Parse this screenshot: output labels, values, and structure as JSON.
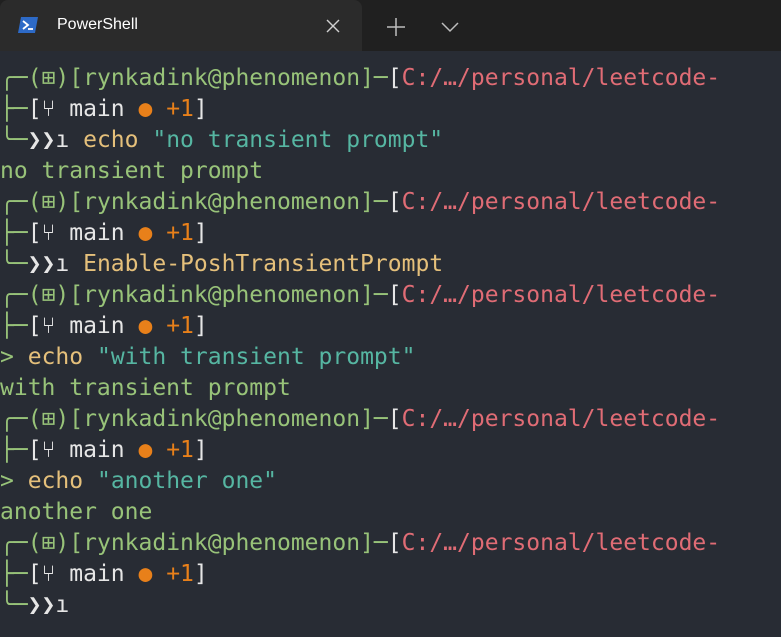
{
  "tab": {
    "title": "PowerShell"
  },
  "prompt": {
    "box_tl": "╭─",
    "box_ml": "├─",
    "box_bl": "╰─",
    "open_paren": "(",
    "close_paren": ")",
    "user_host": "[rynkadink@phenomenon]",
    "dash": "─",
    "path_open": "[",
    "path": "C:/…/personal/leetcode-",
    "git_open": "[",
    "branch": "main",
    "dot": "●",
    "changes": "+1",
    "git_close": "]",
    "arrow_glyph": "❯❯",
    "transient": ">"
  },
  "lines": {
    "cmd1": "echo",
    "cmd1_arg": "\"no transient prompt\"",
    "out1": "no transient prompt",
    "cmd2": "Enable-PoshTransientPrompt",
    "cmd3": "echo",
    "cmd3_arg": "\"with transient prompt\"",
    "out3": "with transient prompt",
    "cmd4": "echo",
    "cmd4_arg": "\"another one\"",
    "out4": "another one"
  },
  "colors": {
    "background": "#282c34",
    "titlebar": "#202020",
    "tab": "#2b2b2b",
    "prompt_green": "#98c379",
    "path_red": "#e06c75",
    "command_yellow": "#e5c07b",
    "string_teal": "#56b6a2",
    "dot_orange": "#e8801a"
  }
}
